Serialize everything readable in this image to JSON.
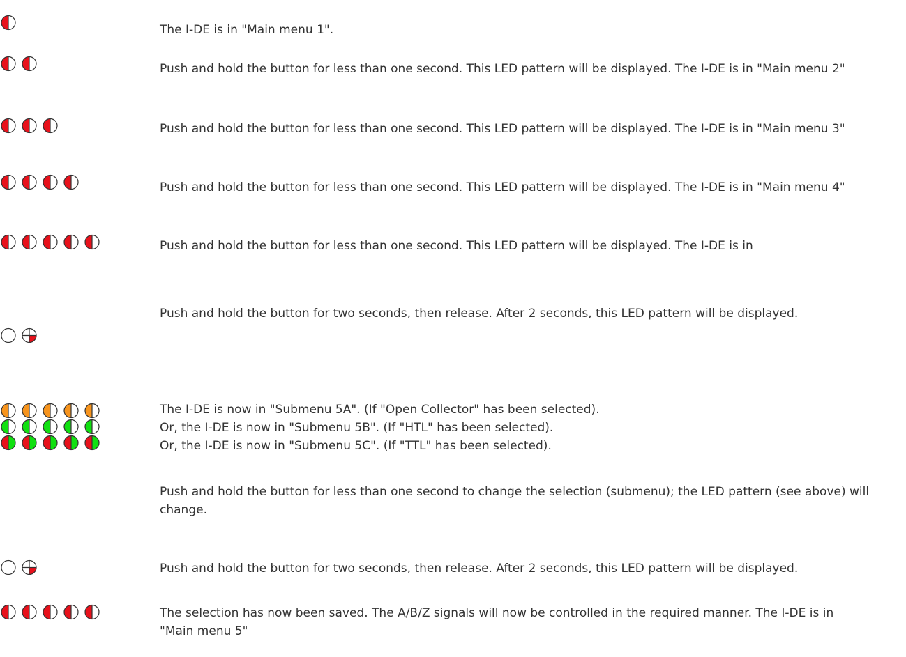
{
  "colors": {
    "red": "#e8111b",
    "white": "#ffffff",
    "orange": "#f7941d",
    "green": "#11e011",
    "outline": "#333333"
  },
  "steps": [
    {
      "leds": [
        [
          "rw"
        ]
      ],
      "text": [
        "The I-DE is in \"Main menu 1\"."
      ]
    },
    {
      "leds": [
        [
          "rw",
          "rw"
        ]
      ],
      "text": [
        "Push and hold the button for less than one second. This LED pattern will be displayed. The I-DE is in \"Main menu 2\""
      ]
    },
    {
      "leds": [
        [
          "rw",
          "rw",
          "rw"
        ]
      ],
      "text": [
        "Push and hold the button for less than one second. This LED pattern will be displayed. The I-DE is in \"Main menu 3\""
      ]
    },
    {
      "leds": [
        [
          "rw",
          "rw",
          "rw",
          "rw"
        ]
      ],
      "text": [
        "Push and hold the button for less than one second. This LED pattern will be displayed. The I-DE is in \"Main menu 4\""
      ]
    },
    {
      "leds": [
        [
          "rw",
          "rw",
          "rw",
          "rw",
          "rw"
        ]
      ],
      "text": [
        "Push and hold the button for less than one second. This LED pattern will be displayed. The I-DE is in"
      ]
    },
    {
      "leds": [
        [
          "off",
          "quarter"
        ]
      ],
      "text": [
        "Push and hold the button for two seconds, then release. After 2 seconds, this LED pattern will be displayed."
      ]
    },
    {
      "leds": [
        [
          "ow",
          "ow",
          "ow",
          "ow",
          "ow"
        ],
        [
          "gw",
          "gw",
          "gw",
          "gw",
          "gw"
        ],
        [
          "rg",
          "rg",
          "rg",
          "rg",
          "rg"
        ]
      ],
      "text": [
        "The I-DE is now in \"Submenu 5A\". (If \"Open Collector\" has been selected).",
        "Or, the I-DE is now in \"Submenu 5B\". (If \"HTL\" has been selected).",
        "Or, the I-DE is now in \"Submenu 5C\". (If \"TTL\" has been selected)."
      ]
    },
    {
      "leds": [],
      "text": [
        "Push and hold the button for less than one second to change the selection (submenu); the LED pattern (see above) will change."
      ]
    },
    {
      "leds": [
        [
          "off",
          "quarter"
        ]
      ],
      "text": [
        "Push and hold the button for two seconds, then release. After 2 seconds, this LED pattern will be displayed."
      ]
    },
    {
      "leds": [
        [
          "rw",
          "rw",
          "rw",
          "rw",
          "rw"
        ]
      ],
      "text": [
        "The selection has now been saved. The A/B/Z signals will now be controlled in the required manner. The I-DE is in \"Main menu 5\""
      ]
    }
  ]
}
